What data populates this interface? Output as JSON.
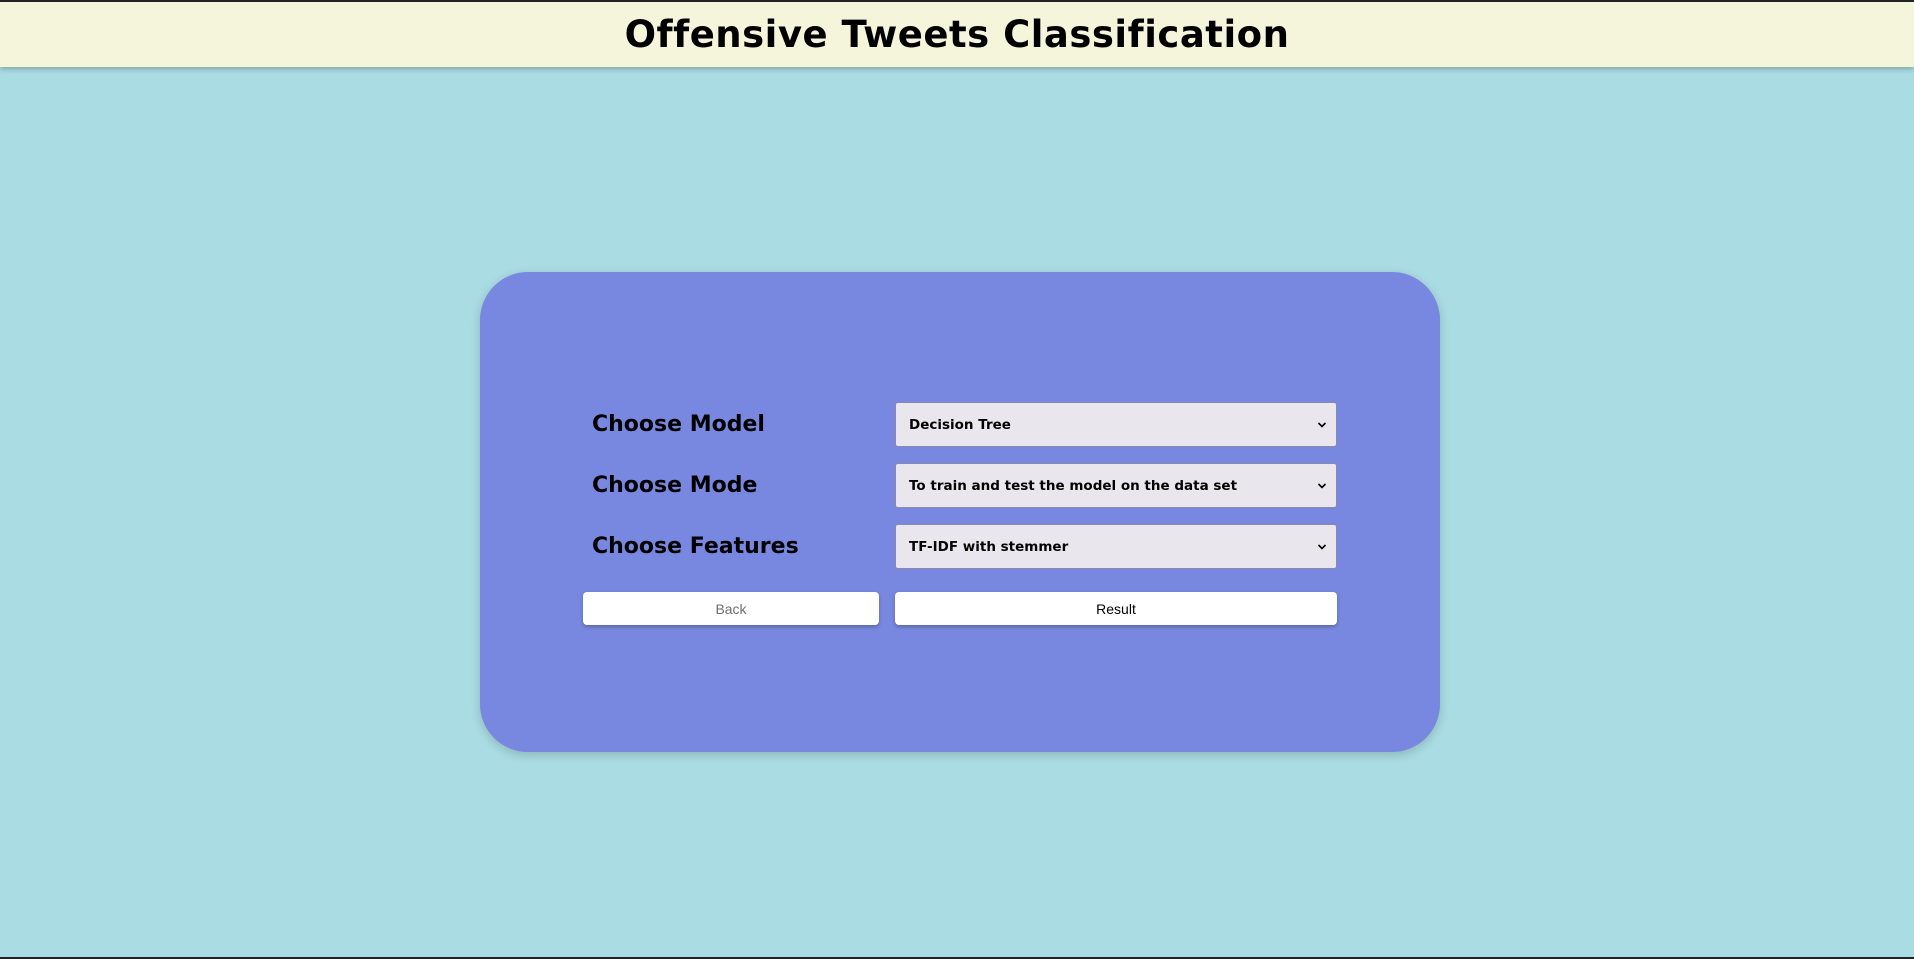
{
  "header": {
    "title": "Offensive Tweets Classification"
  },
  "form": {
    "model": {
      "label": "Choose Model",
      "selected": "Decision Tree"
    },
    "mode": {
      "label": "Choose Mode",
      "selected": "To train and test the model on the data set"
    },
    "features": {
      "label": "Choose Features",
      "selected": "TF-IDF with stemmer"
    },
    "buttons": {
      "back_label": "Back",
      "result_label": "Result"
    }
  },
  "icons": {
    "dropdown": "chevron-down-icon"
  },
  "colors": {
    "page_background": "#aadce3",
    "header_background": "#f5f5dc",
    "card_background": "#7888e0",
    "select_background": "#e9e7ed"
  }
}
